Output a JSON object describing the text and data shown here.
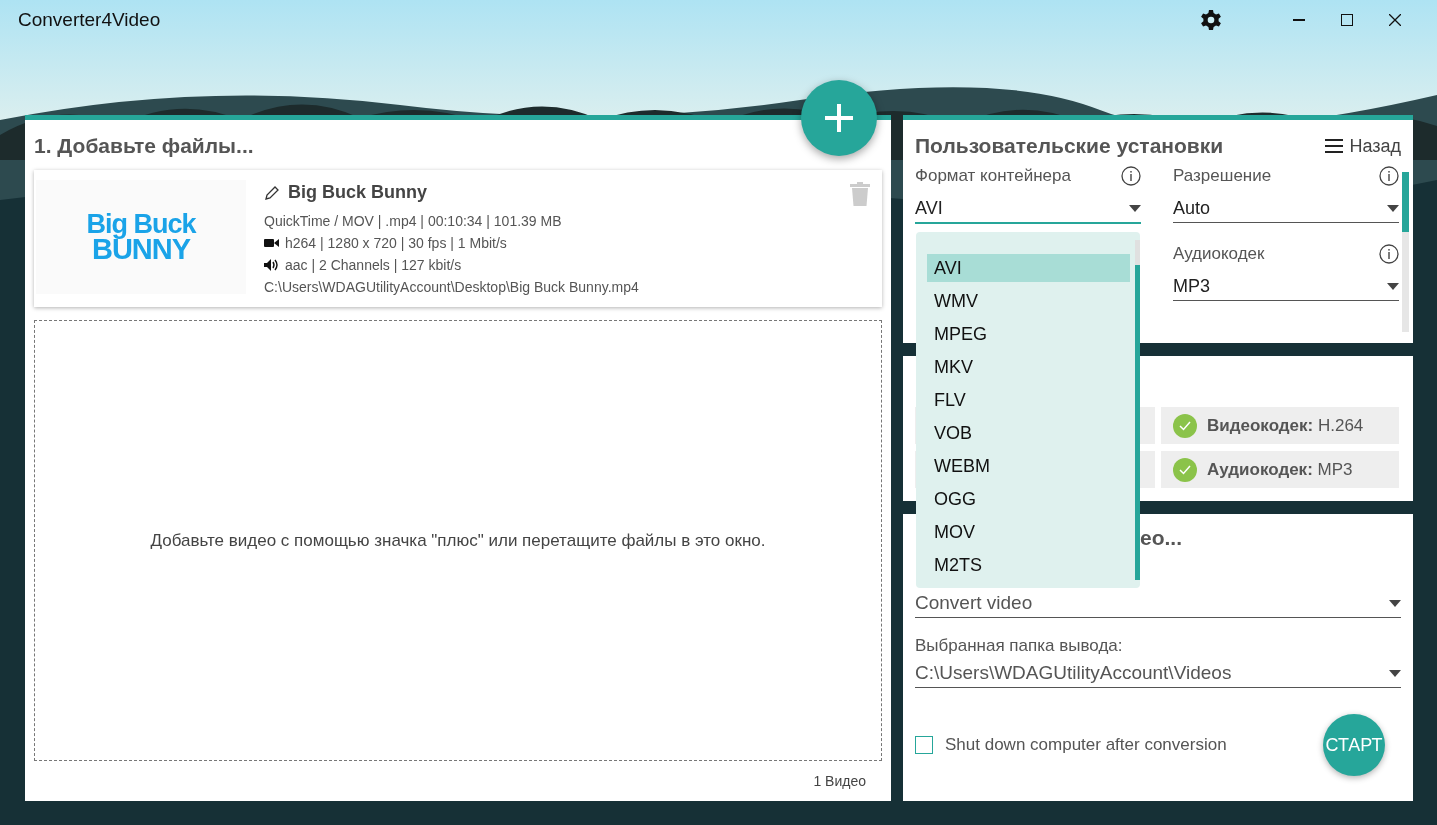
{
  "window": {
    "title": "Converter4Video"
  },
  "files": {
    "heading": "1. Добавьте файлы...",
    "items": [
      {
        "name": "Big Buck Bunny",
        "thumbnail": {
          "line1": "Big Buck",
          "line2": "BUNNY"
        },
        "details": [
          {
            "kind": "container",
            "text": "QuickTime / MOV | .mp4 | 00:10:34 | 101.39 MB"
          },
          {
            "kind": "video",
            "text": "h264 | 1280 x 720 | 30 fps | 1 Mbit/s"
          },
          {
            "kind": "audio",
            "text": "aac | 2 Channels | 127 kbit/s"
          },
          {
            "kind": "path",
            "text": "C:\\Users\\WDAGUtilityAccount\\Desktop\\Big Buck Bunny.mp4"
          }
        ]
      }
    ],
    "drop_hint": "Добавьте видео с помощью значка \"плюс\" или перетащите файлы в это окно.",
    "count": "1 Видео"
  },
  "settings": {
    "heading": "Пользовательские установки",
    "back": "Назад",
    "fields": [
      {
        "label": "Формат контейнера",
        "value": "AVI",
        "expanded": true
      },
      {
        "label": "Разрешение",
        "value": "Auto",
        "expanded": false
      },
      {
        "label": "Аудиокодек",
        "value": "MP3",
        "expanded": false
      }
    ],
    "dropdown": [
      {
        "label": "AVI",
        "selected": true
      },
      {
        "label": "WMV",
        "selected": false
      },
      {
        "label": "MPEG",
        "selected": false
      },
      {
        "label": "MKV",
        "selected": false
      },
      {
        "label": "FLV",
        "selected": false
      },
      {
        "label": "VOB",
        "selected": false
      },
      {
        "label": "WEBM",
        "selected": false
      },
      {
        "label": "OGG",
        "selected": false
      },
      {
        "label": "MOV",
        "selected": false
      },
      {
        "label": "M2TS",
        "selected": false
      }
    ]
  },
  "summary": {
    "chips": [
      {
        "label": "Видеокодек:",
        "value": "H.264",
        "ok": true
      },
      {
        "label": "Аудиокодек:",
        "value": "MP3",
        "ok": true
      }
    ]
  },
  "output": {
    "heading": "ео...",
    "mode": "Convert video",
    "folder_label": "Выбранная папка вывода:",
    "folder": "C:\\Users\\WDAGUtilityAccount\\Videos",
    "shutdown": {
      "label": "Shut down computer after conversion",
      "checked": false
    },
    "start": "СТАРТ"
  }
}
